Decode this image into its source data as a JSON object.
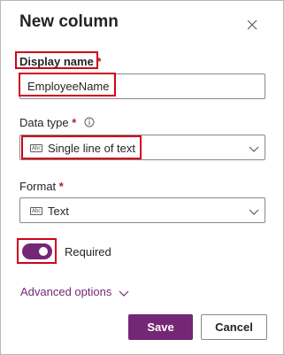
{
  "panel": {
    "title": "New column",
    "close_icon": "close-icon"
  },
  "display_name": {
    "label": "Display name",
    "required_mark": "*",
    "value": "EmployeeName"
  },
  "data_type": {
    "label": "Data type",
    "required_mark": "*",
    "info_icon": "info-icon",
    "type_icon": "abc-icon",
    "selected": "Single line of text"
  },
  "format": {
    "label": "Format",
    "required_mark": "*",
    "type_icon": "abc-icon",
    "selected": "Text"
  },
  "required_toggle": {
    "label": "Required",
    "on": true
  },
  "advanced": {
    "label": "Advanced options"
  },
  "actions": {
    "save_label": "Save",
    "cancel_label": "Cancel"
  },
  "colors": {
    "accent": "#742774",
    "required": "#a4262c",
    "highlight": "#d0021b"
  }
}
